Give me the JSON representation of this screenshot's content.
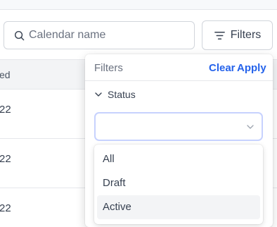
{
  "search": {
    "placeholder": "Calendar name",
    "value": ""
  },
  "toolbar": {
    "filters_label": "Filters"
  },
  "table": {
    "header_fragment": "ed",
    "row_fragments": [
      "22",
      "22",
      "22"
    ]
  },
  "filter_panel": {
    "title": "Filters",
    "clear_label": "Clear",
    "apply_label": "Apply",
    "section_label": "Status",
    "select_value": "",
    "options": [
      "All",
      "Draft",
      "Active"
    ],
    "highlighted_option": "Active"
  },
  "colors": {
    "accent": "#2563eb",
    "focus_ring": "#c7d2fe"
  }
}
